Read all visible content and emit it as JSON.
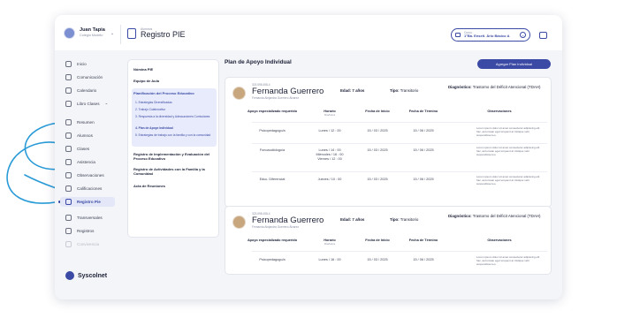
{
  "user": {
    "name": "Juan Tapia",
    "role": "Colegio Modelo"
  },
  "header": {
    "eyebrow": "Alumnos",
    "title": "Registro PIE"
  },
  "course": {
    "label": "Curso",
    "value": "1°Bá. Enseñ. Ário Básico A"
  },
  "sidebar": {
    "items": [
      {
        "label": "Inicio"
      },
      {
        "label": "Comunicación"
      },
      {
        "label": "Calendario"
      },
      {
        "label": "Libro Clases"
      },
      {
        "label": "Resumen"
      },
      {
        "label": "Alumnos"
      },
      {
        "label": "Clases"
      },
      {
        "label": "Asistencia"
      },
      {
        "label": "Observaciones"
      },
      {
        "label": "Calificaciones"
      },
      {
        "label": "Registro Pie"
      },
      {
        "label": "Transversales"
      },
      {
        "label": "Registros"
      },
      {
        "label": "Convivencia"
      }
    ],
    "libro_chevron": "⌄",
    "brand": "Syscolnet"
  },
  "subnav": {
    "items": [
      "Nómina PIE",
      "Equipo de Aula",
      "Planificación del Proceso Educativo",
      "Registro de Implementación y Evaluación del Proceso Educativo",
      "Registro de Actividades con la Familia y la Comunidad",
      "Acta de Reuniones"
    ],
    "sub_items": [
      "1. Estrategias Diversificadas",
      "2. Trabajo Colaborativo",
      "3. Respuesta a la diversidad y Adecuaciones Curriculares",
      "4. Plan de Apoyo Individual",
      "5. Estrategias de trabajo con la familia y con la comunidad"
    ]
  },
  "main": {
    "title": "Plan de Apoyo Individual",
    "add_button": "Agregar Plan Individual",
    "columns": [
      "Apoyo especializado requerido",
      "Horario",
      "Fecha de Inicio",
      "Fecha de Término",
      "Observaciones"
    ],
    "horario_sub": "Día/Hora",
    "lorem": "Lorem ipsum dolor sit amet consectetur adipiscing elit hac, accumsan eget torquent at tristique velit suspendisse leo.",
    "cards": [
      {
        "rut": "323.698.458-4",
        "name": "Fernanda Guerrero",
        "sub": "Fernanda Alejandra Guerrero Álvarez",
        "edad": "Edad: 7 años",
        "tipo_label": "Tipo:",
        "tipo": "Transitorio",
        "dx_label": "Diagnóstico:",
        "dx": "Trastorno del Déficit Atencional (TDAH)",
        "rows": [
          {
            "apoyo": "Psicopedagogo/a",
            "horario": "Lunes / 12 : 00",
            "inicio": "15 / 03 / 2025",
            "termino": "15 / 06 / 2025"
          },
          {
            "apoyo": "Fonoaudiólogo/a",
            "horario": "Lunes / 14 : 00\nMiércoles / 16 : 00\nViernes / 12 : 00",
            "inicio": "15 / 03 / 2025",
            "termino": "15 / 06 / 2025"
          },
          {
            "apoyo": "Educ. Diferencial",
            "horario": "Jueves / 10 : 00",
            "inicio": "15 / 03 / 2025",
            "termino": "15 / 06 / 2025"
          }
        ]
      },
      {
        "rut": "323.698.458-4",
        "name": "Fernanda Guerrero",
        "sub": "Fernanda Alejandra Guerrero Álvarez",
        "edad": "Edad: 7 años",
        "tipo_label": "Tipo:",
        "tipo": "Transitorio",
        "dx_label": "Diagnóstico:",
        "dx": "Trastorno del Déficit Atencional (TDAH)",
        "rows": [
          {
            "apoyo": "Psicopedagogo/a",
            "horario": "Lunes / 16 : 00",
            "inicio": "15 / 03 / 2025",
            "termino": "15 / 06 / 2025"
          }
        ]
      }
    ]
  },
  "colors": {
    "accent": "#3b4aa5",
    "swirl": "#2a9bd7"
  }
}
